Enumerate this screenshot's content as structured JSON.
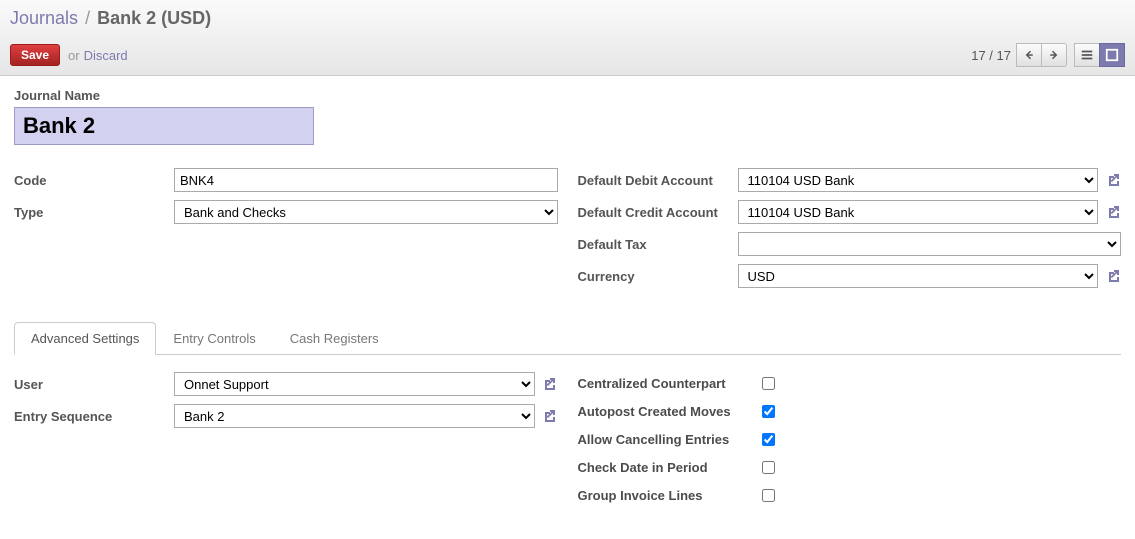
{
  "breadcrumb": {
    "parent": "Journals",
    "current": "Bank 2 (USD)"
  },
  "toolbar": {
    "save": "Save",
    "or": "or",
    "discard": "Discard"
  },
  "pager": {
    "text": "17 / 17"
  },
  "journalName": {
    "label": "Journal Name",
    "value": "Bank 2"
  },
  "left": {
    "codeLabel": "Code",
    "codeValue": "BNK4",
    "typeLabel": "Type",
    "typeValue": "Bank and Checks"
  },
  "right": {
    "debitLabel": "Default Debit Account",
    "debitValue": "110104 USD Bank",
    "creditLabel": "Default Credit Account",
    "creditValue": "110104 USD Bank",
    "taxLabel": "Default Tax",
    "taxValue": "",
    "currencyLabel": "Currency",
    "currencyValue": "USD"
  },
  "tabs": {
    "advanced": "Advanced Settings",
    "entry": "Entry Controls",
    "cash": "Cash Registers"
  },
  "adv": {
    "userLabel": "User",
    "userValue": "Onnet Support",
    "seqLabel": "Entry Sequence",
    "seqValue": "Bank 2",
    "centralized": "Centralized Counterpart",
    "autopost": "Autopost Created Moves",
    "cancel": "Allow Cancelling Entries",
    "checkDate": "Check Date in Period",
    "groupInv": "Group Invoice Lines"
  },
  "checks": {
    "centralized": false,
    "autopost": true,
    "cancel": true,
    "checkDate": false,
    "groupInv": false
  }
}
